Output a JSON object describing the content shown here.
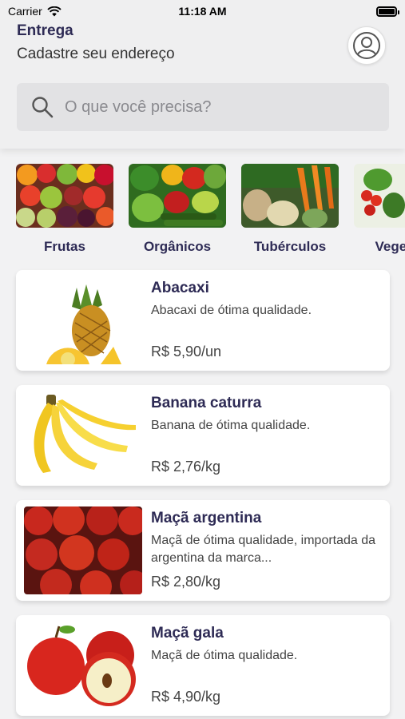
{
  "status_bar": {
    "carrier": "Carrier",
    "time": "11:18 AM"
  },
  "header": {
    "title": "Entrega",
    "subtitle": "Cadastre seu endereço",
    "search_placeholder": "O que você precisa?"
  },
  "categories": [
    {
      "label": "Frutas",
      "icon": "fruits-image"
    },
    {
      "label": "Orgânicos",
      "icon": "organic-vegetables-image"
    },
    {
      "label": "Tubérculos",
      "icon": "tubers-image"
    },
    {
      "label": "Vegetais",
      "icon": "vegetables-image"
    }
  ],
  "products": [
    {
      "name": "Abacaxi",
      "description": "Abacaxi de ótima qualidade.",
      "price": "R$ 5,90/un",
      "icon": "pineapple-image"
    },
    {
      "name": "Banana caturra",
      "description": "Banana de ótima qualidade.",
      "price": "R$ 2,76/kg",
      "icon": "banana-image"
    },
    {
      "name": "Maçã argentina",
      "description": "Maçã de ótima qualidade, importada da argentina da marca...",
      "price": "R$ 2,80/kg",
      "icon": "apples-image"
    },
    {
      "name": "Maçã gala",
      "description": "Maçã de ótima qualidade.",
      "price": "R$ 4,90/kg",
      "icon": "apple-gala-image"
    }
  ],
  "colors": {
    "brand": "#2e2b55",
    "background": "#f2f2f3",
    "search_bg": "#e2e2e4"
  }
}
